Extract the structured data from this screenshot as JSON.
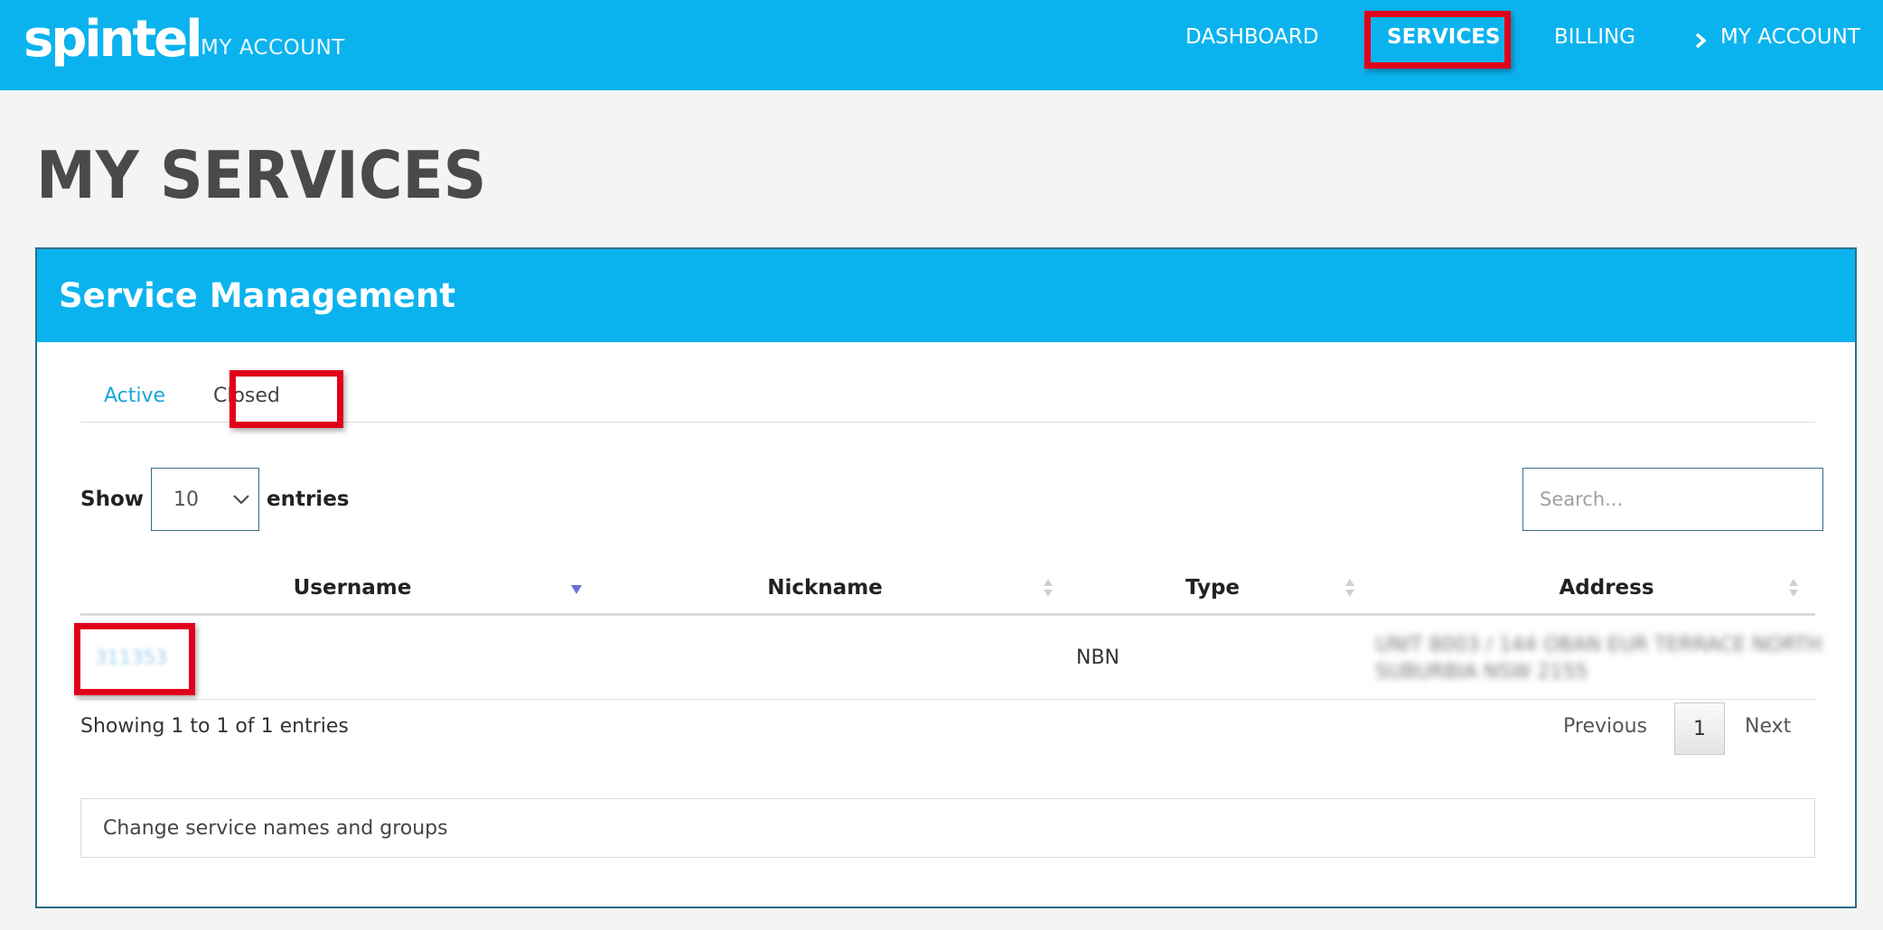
{
  "header": {
    "logo_text": "spintel",
    "brand_subtitle": "MY ACCOUNT",
    "nav": [
      {
        "label": "DASHBOARD",
        "active": false
      },
      {
        "label": "SERVICES",
        "active": true
      },
      {
        "label": "BILLING",
        "active": false
      },
      {
        "label": "MY ACCOUNT",
        "active": false
      }
    ]
  },
  "page": {
    "title": "MY SERVICES"
  },
  "panel": {
    "title": "Service Management",
    "tabs": [
      {
        "label": "Active",
        "selected": false
      },
      {
        "label": "Closed",
        "selected": true
      }
    ],
    "show_label": "Show",
    "entries_label": "entries",
    "page_size": "10",
    "search_placeholder": "Search..."
  },
  "table": {
    "columns": [
      "Username",
      "Nickname",
      "Type",
      "Address"
    ],
    "rows": [
      {
        "username": "311353",
        "nickname": "",
        "type": "NBN",
        "address": "UNIT 8003 / 144 OBAN EUR TERRACE NORTH SUBURBIA NSW 2155"
      }
    ],
    "info": "Showing 1 to 1 of 1 entries",
    "pagination": {
      "previous": "Previous",
      "current": "1",
      "next": "Next"
    }
  },
  "footer": {
    "change_names": "Change service names and groups"
  },
  "colors": {
    "brand_blue": "#0bb3ee",
    "highlight_red": "#e1001a",
    "link_blue": "#1aa4dc"
  }
}
